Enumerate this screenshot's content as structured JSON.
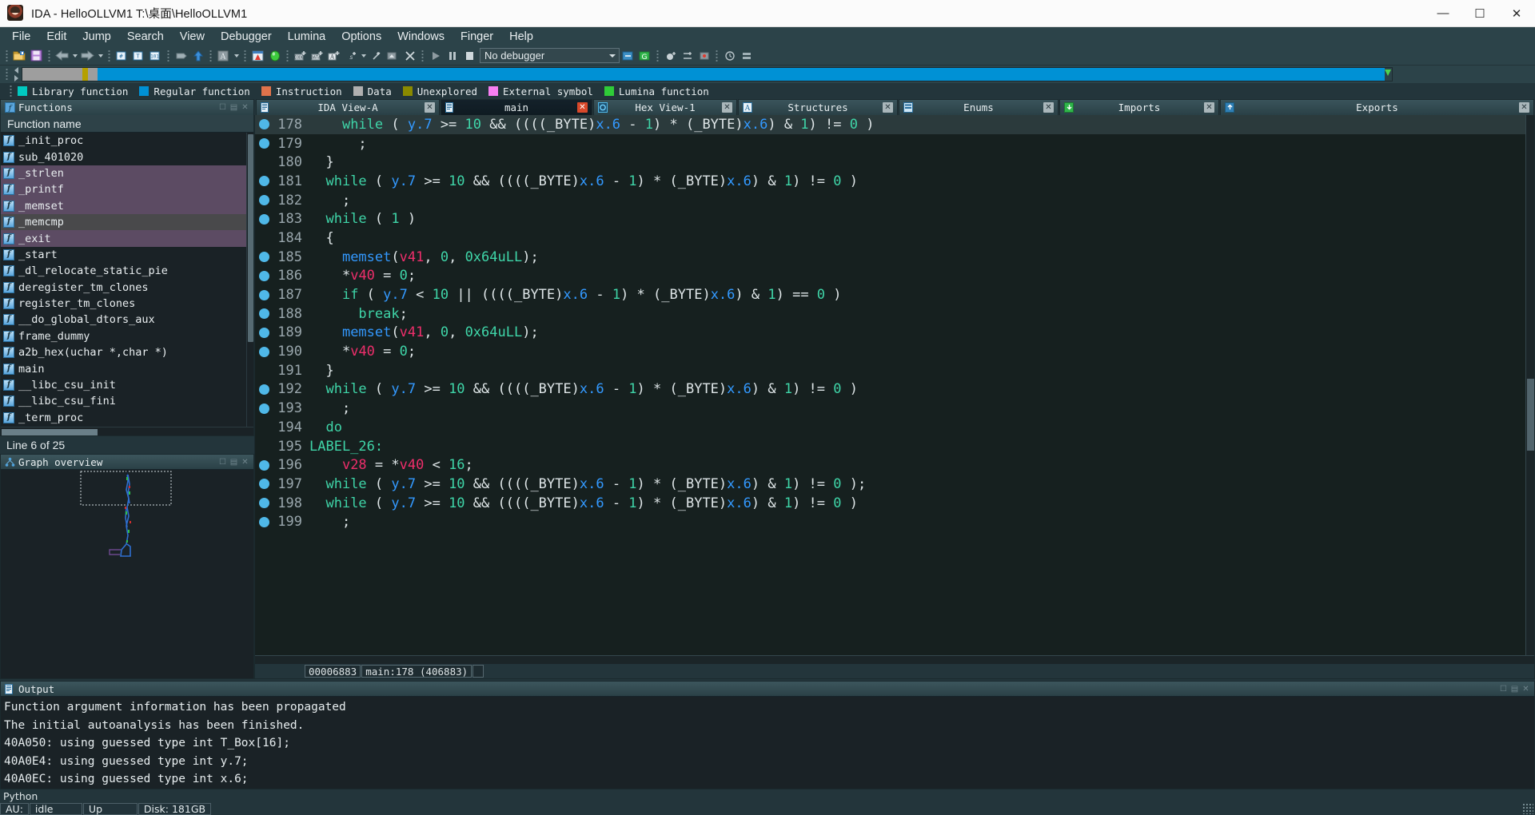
{
  "window": {
    "title": "IDA - HelloOLLVM1 T:\\桌面\\HelloOLLVM1",
    "app_icon": "ida-logo-icon",
    "minimize": "—",
    "maximize": "☐",
    "close": "✕"
  },
  "menu": [
    "File",
    "Edit",
    "Jump",
    "Search",
    "View",
    "Debugger",
    "Lumina",
    "Options",
    "Windows",
    "Finger",
    "Help"
  ],
  "toolbar": {
    "debugger_select": "No debugger",
    "icons": [
      "open-file-icon",
      "save-icon",
      "back-icon",
      "forward-icon",
      "search-hex-icon",
      "search-text-icon",
      "search-imm-icon",
      "binary-search-icon",
      "jump-up-icon",
      "text-style-icon",
      "alert-icon",
      "run-to-icon",
      "code-icon",
      "data-icon",
      "ascii-icon",
      "struct-icon",
      "undefine-icon",
      "make-func-icon",
      "delete-icon",
      "start-process-icon",
      "pause-icon",
      "stop-icon"
    ]
  },
  "navband": {
    "segments": [
      {
        "name": "library",
        "color": "#9e9e9e",
        "width_pct": 4.4
      },
      {
        "name": "separator",
        "color": "#b5a000",
        "width_pct": 0.4
      },
      {
        "name": "gap",
        "color": "#9e9e9e",
        "width_pct": 0.7
      },
      {
        "name": "regular",
        "color": "#0091d5",
        "width_pct": 94.5
      }
    ],
    "marker": "current-position-marker"
  },
  "legend": [
    {
      "label": "Library function",
      "color": "#00c9c0"
    },
    {
      "label": "Regular function",
      "color": "#0091d5"
    },
    {
      "label": "Instruction",
      "color": "#e0734b"
    },
    {
      "label": "Data",
      "color": "#b0b0b0"
    },
    {
      "label": "Unexplored",
      "color": "#8a8a00"
    },
    {
      "label": "External symbol",
      "color": "#f77ff2"
    },
    {
      "label": "Lumina function",
      "color": "#2fcc38"
    }
  ],
  "left_panel": {
    "dock_title": "Functions",
    "dock_icon": "functions-icon",
    "column_header": "Function name",
    "functions": [
      {
        "name": "_init_proc",
        "kind": "normal"
      },
      {
        "name": "sub_401020",
        "kind": "normal"
      },
      {
        "name": "_strlen",
        "kind": "library"
      },
      {
        "name": "_printf",
        "kind": "library"
      },
      {
        "name": "_memset",
        "kind": "library"
      },
      {
        "name": "_memcmp",
        "kind": "selected"
      },
      {
        "name": "_exit",
        "kind": "library"
      },
      {
        "name": "_start",
        "kind": "normal"
      },
      {
        "name": "_dl_relocate_static_pie",
        "kind": "normal"
      },
      {
        "name": "deregister_tm_clones",
        "kind": "normal"
      },
      {
        "name": "register_tm_clones",
        "kind": "normal"
      },
      {
        "name": "__do_global_dtors_aux",
        "kind": "normal"
      },
      {
        "name": "frame_dummy",
        "kind": "normal"
      },
      {
        "name": "a2b_hex(uchar *,char *)",
        "kind": "normal"
      },
      {
        "name": "main",
        "kind": "normal"
      },
      {
        "name": "__libc_csu_init",
        "kind": "normal"
      },
      {
        "name": "__libc_csu_fini",
        "kind": "normal"
      },
      {
        "name": "_term_proc",
        "kind": "normal"
      }
    ],
    "line_status": "Line 6 of 25",
    "graph_overview": {
      "title": "Graph overview",
      "icon": "graph-overview-icon"
    }
  },
  "tabs": [
    {
      "label": "IDA View-A",
      "icon": "doc-icon",
      "close": "✕",
      "active": false,
      "close_style": "grey"
    },
    {
      "label": "main",
      "icon": "doc-icon",
      "close": "✕",
      "active": true,
      "close_style": "red"
    },
    {
      "label": "Hex View-1",
      "icon": "hex-icon",
      "close": "✕",
      "active": false,
      "close_style": "grey"
    },
    {
      "label": "Structures",
      "icon": "struct-icon",
      "close": "✕",
      "active": false,
      "close_style": "grey"
    },
    {
      "label": "Enums",
      "icon": "enum-icon",
      "close": "✕",
      "active": false,
      "close_style": "grey"
    },
    {
      "label": "Imports",
      "icon": "imports-icon",
      "close": "✕",
      "active": false,
      "close_style": "grey"
    },
    {
      "label": "Exports",
      "icon": "exports-icon",
      "close": "✕",
      "active": false,
      "close_style": "grey"
    }
  ],
  "code": {
    "lines": [
      {
        "n": "178",
        "bp": true,
        "current": true,
        "indent": 4,
        "tokens": [
          [
            "kw",
            "while"
          ],
          [
            "plain",
            " ( "
          ],
          [
            "gvar",
            "y.7"
          ],
          [
            "plain",
            " >= "
          ],
          [
            "num",
            "10"
          ],
          [
            "plain",
            " && (((("
          ],
          [
            "plain",
            "_BYTE)"
          ],
          [
            "gvar",
            "x.6"
          ],
          [
            "plain",
            " - "
          ],
          [
            "num",
            "1"
          ],
          [
            "plain",
            ") * ("
          ],
          [
            "plain",
            "_BYTE)"
          ],
          [
            "gvar",
            "x.6"
          ],
          [
            "plain",
            ") & "
          ],
          [
            "num",
            "1"
          ],
          [
            "plain",
            ") != "
          ],
          [
            "num",
            "0"
          ],
          [
            "plain",
            " )"
          ]
        ]
      },
      {
        "n": "179",
        "bp": true,
        "current": false,
        "indent": 6,
        "tokens": [
          [
            "plain",
            ";"
          ]
        ]
      },
      {
        "n": "180",
        "bp": false,
        "current": false,
        "indent": 2,
        "tokens": [
          [
            "plain",
            "}"
          ]
        ]
      },
      {
        "n": "181",
        "bp": true,
        "current": false,
        "indent": 2,
        "tokens": [
          [
            "kw",
            "while"
          ],
          [
            "plain",
            " ( "
          ],
          [
            "gvar",
            "y.7"
          ],
          [
            "plain",
            " >= "
          ],
          [
            "num",
            "10"
          ],
          [
            "plain",
            " && (((("
          ],
          [
            "plain",
            "_BYTE)"
          ],
          [
            "gvar",
            "x.6"
          ],
          [
            "plain",
            " - "
          ],
          [
            "num",
            "1"
          ],
          [
            "plain",
            ") * ("
          ],
          [
            "plain",
            "_BYTE)"
          ],
          [
            "gvar",
            "x.6"
          ],
          [
            "plain",
            ") & "
          ],
          [
            "num",
            "1"
          ],
          [
            "plain",
            ") != "
          ],
          [
            "num",
            "0"
          ],
          [
            "plain",
            " )"
          ]
        ]
      },
      {
        "n": "182",
        "bp": true,
        "current": false,
        "indent": 4,
        "tokens": [
          [
            "plain",
            ";"
          ]
        ]
      },
      {
        "n": "183",
        "bp": true,
        "current": false,
        "indent": 2,
        "tokens": [
          [
            "kw",
            "while"
          ],
          [
            "plain",
            " ( "
          ],
          [
            "num",
            "1"
          ],
          [
            "plain",
            " )"
          ]
        ]
      },
      {
        "n": "184",
        "bp": false,
        "current": false,
        "indent": 2,
        "tokens": [
          [
            "plain",
            "{"
          ]
        ]
      },
      {
        "n": "185",
        "bp": true,
        "current": false,
        "indent": 4,
        "tokens": [
          [
            "call",
            "memset"
          ],
          [
            "plain",
            "("
          ],
          [
            "var",
            "v41"
          ],
          [
            "plain",
            ", "
          ],
          [
            "num",
            "0"
          ],
          [
            "plain",
            ", "
          ],
          [
            "num",
            "0x64uLL"
          ],
          [
            "plain",
            ");"
          ]
        ]
      },
      {
        "n": "186",
        "bp": true,
        "current": false,
        "indent": 4,
        "tokens": [
          [
            "plain",
            "*"
          ],
          [
            "var",
            "v40"
          ],
          [
            "plain",
            " = "
          ],
          [
            "num",
            "0"
          ],
          [
            "plain",
            ";"
          ]
        ]
      },
      {
        "n": "187",
        "bp": true,
        "current": false,
        "indent": 4,
        "tokens": [
          [
            "kw",
            "if"
          ],
          [
            "plain",
            " ( "
          ],
          [
            "gvar",
            "y.7"
          ],
          [
            "plain",
            " < "
          ],
          [
            "num",
            "10"
          ],
          [
            "plain",
            " || (((("
          ],
          [
            "plain",
            "_BYTE)"
          ],
          [
            "gvar",
            "x.6"
          ],
          [
            "plain",
            " - "
          ],
          [
            "num",
            "1"
          ],
          [
            "plain",
            ") * ("
          ],
          [
            "plain",
            "_BYTE)"
          ],
          [
            "gvar",
            "x.6"
          ],
          [
            "plain",
            ") & "
          ],
          [
            "num",
            "1"
          ],
          [
            "plain",
            ") == "
          ],
          [
            "num",
            "0"
          ],
          [
            "plain",
            " )"
          ]
        ]
      },
      {
        "n": "188",
        "bp": true,
        "current": false,
        "indent": 6,
        "tokens": [
          [
            "kw",
            "break"
          ],
          [
            "plain",
            ";"
          ]
        ]
      },
      {
        "n": "189",
        "bp": true,
        "current": false,
        "indent": 4,
        "tokens": [
          [
            "call",
            "memset"
          ],
          [
            "plain",
            "("
          ],
          [
            "var",
            "v41"
          ],
          [
            "plain",
            ", "
          ],
          [
            "num",
            "0"
          ],
          [
            "plain",
            ", "
          ],
          [
            "num",
            "0x64uLL"
          ],
          [
            "plain",
            ");"
          ]
        ]
      },
      {
        "n": "190",
        "bp": true,
        "current": false,
        "indent": 4,
        "tokens": [
          [
            "plain",
            "*"
          ],
          [
            "var",
            "v40"
          ],
          [
            "plain",
            " = "
          ],
          [
            "num",
            "0"
          ],
          [
            "plain",
            ";"
          ]
        ]
      },
      {
        "n": "191",
        "bp": false,
        "current": false,
        "indent": 2,
        "tokens": [
          [
            "plain",
            "}"
          ]
        ]
      },
      {
        "n": "192",
        "bp": true,
        "current": false,
        "indent": 2,
        "tokens": [
          [
            "kw",
            "while"
          ],
          [
            "plain",
            " ( "
          ],
          [
            "gvar",
            "y.7"
          ],
          [
            "plain",
            " >= "
          ],
          [
            "num",
            "10"
          ],
          [
            "plain",
            " && (((("
          ],
          [
            "plain",
            "_BYTE)"
          ],
          [
            "gvar",
            "x.6"
          ],
          [
            "plain",
            " - "
          ],
          [
            "num",
            "1"
          ],
          [
            "plain",
            ") * ("
          ],
          [
            "plain",
            "_BYTE)"
          ],
          [
            "gvar",
            "x.6"
          ],
          [
            "plain",
            ") & "
          ],
          [
            "num",
            "1"
          ],
          [
            "plain",
            ") != "
          ],
          [
            "num",
            "0"
          ],
          [
            "plain",
            " )"
          ]
        ]
      },
      {
        "n": "193",
        "bp": true,
        "current": false,
        "indent": 4,
        "tokens": [
          [
            "plain",
            ";"
          ]
        ]
      },
      {
        "n": "194",
        "bp": false,
        "current": false,
        "indent": 2,
        "tokens": [
          [
            "kw",
            "do"
          ]
        ]
      },
      {
        "n": "195",
        "bp": false,
        "current": false,
        "indent": 0,
        "tokens": [
          [
            "lbl",
            "LABEL_26:"
          ]
        ]
      },
      {
        "n": "196",
        "bp": true,
        "current": false,
        "indent": 4,
        "tokens": [
          [
            "var",
            "v28"
          ],
          [
            "plain",
            " = *"
          ],
          [
            "var",
            "v40"
          ],
          [
            "plain",
            " < "
          ],
          [
            "num",
            "16"
          ],
          [
            "plain",
            ";"
          ]
        ]
      },
      {
        "n": "197",
        "bp": true,
        "current": false,
        "indent": 2,
        "tokens": [
          [
            "kw",
            "while"
          ],
          [
            "plain",
            " ( "
          ],
          [
            "gvar",
            "y.7"
          ],
          [
            "plain",
            " >= "
          ],
          [
            "num",
            "10"
          ],
          [
            "plain",
            " && (((("
          ],
          [
            "plain",
            "_BYTE)"
          ],
          [
            "gvar",
            "x.6"
          ],
          [
            "plain",
            " - "
          ],
          [
            "num",
            "1"
          ],
          [
            "plain",
            ") * ("
          ],
          [
            "plain",
            "_BYTE)"
          ],
          [
            "gvar",
            "x.6"
          ],
          [
            "plain",
            ") & "
          ],
          [
            "num",
            "1"
          ],
          [
            "plain",
            ") != "
          ],
          [
            "num",
            "0"
          ],
          [
            "plain",
            " );"
          ]
        ]
      },
      {
        "n": "198",
        "bp": true,
        "current": false,
        "indent": 2,
        "tokens": [
          [
            "kw",
            "while"
          ],
          [
            "plain",
            " ( "
          ],
          [
            "gvar",
            "y.7"
          ],
          [
            "plain",
            " >= "
          ],
          [
            "num",
            "10"
          ],
          [
            "plain",
            " && (((("
          ],
          [
            "plain",
            "_BYTE)"
          ],
          [
            "gvar",
            "x.6"
          ],
          [
            "plain",
            " - "
          ],
          [
            "num",
            "1"
          ],
          [
            "plain",
            ") * ("
          ],
          [
            "plain",
            "_BYTE)"
          ],
          [
            "gvar",
            "x.6"
          ],
          [
            "plain",
            ") & "
          ],
          [
            "num",
            "1"
          ],
          [
            "plain",
            ") != "
          ],
          [
            "num",
            "0"
          ],
          [
            "plain",
            " )"
          ]
        ]
      },
      {
        "n": "199",
        "bp": true,
        "current": false,
        "indent": 4,
        "tokens": [
          [
            "plain",
            ";"
          ]
        ]
      }
    ],
    "status_offset": "00006883",
    "status_location": "main:178 (406883)"
  },
  "output": {
    "title": "Output",
    "icon": "output-icon",
    "lines": [
      "Function argument information has been propagated",
      "The initial autoanalysis has been finished.",
      "40A050: using guessed type int T_Box[16];",
      "40A0E4: using guessed type int y.7;",
      "40A0EC: using guessed type int x.6;"
    ],
    "prompt": "Python"
  },
  "statusbar": {
    "au": "AU:",
    "au_state": "idle",
    "state": "Up",
    "disk": "Disk: 181GB"
  },
  "colors": {
    "accent_blue": "#0091d5",
    "keyword": "#3fd5a8",
    "variable": "#ee2e6b",
    "global": "#3399ff",
    "library_row": "#5c4b63",
    "selected_row": "#49494b"
  }
}
